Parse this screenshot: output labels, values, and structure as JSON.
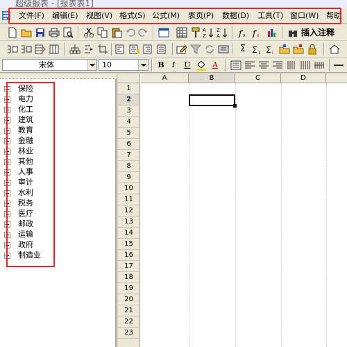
{
  "window": {
    "title": "超级报表 - [报表表1]"
  },
  "menu": {
    "items": [
      {
        "id": "file",
        "label": "文件(F)"
      },
      {
        "id": "edit",
        "label": "编辑(E)"
      },
      {
        "id": "view",
        "label": "视图(V)"
      },
      {
        "id": "format",
        "label": "格式(S)"
      },
      {
        "id": "formula",
        "label": "公式(M)"
      },
      {
        "id": "sheet",
        "label": "表页(P)"
      },
      {
        "id": "data",
        "label": "数据(D)"
      },
      {
        "id": "tools",
        "label": "工具(T)"
      },
      {
        "id": "window",
        "label": "窗口(W)"
      },
      {
        "id": "help",
        "label": "帮助"
      }
    ],
    "highlight_color": "#e0282e"
  },
  "toolbar": {
    "insert_comment_label": "插入注释",
    "sum_symbol": "Σ"
  },
  "format_bar": {
    "font_name": "宋体",
    "font_size": "10",
    "bold": "B",
    "italic": "I",
    "underline": "U",
    "font_color": "A"
  },
  "tree": {
    "items": [
      "保险",
      "电力",
      "化工",
      "建筑",
      "教育",
      "金融",
      "林业",
      "其他",
      "人事",
      "审计",
      "水利",
      "税务",
      "医疗",
      "邮政",
      "运输",
      "政府",
      "制造业"
    ],
    "highlight_color": "#e0282e"
  },
  "sheet": {
    "columns": [
      "A",
      "B",
      "C",
      "D"
    ],
    "rows": [
      "1",
      "2",
      "3",
      "4",
      "5",
      "6",
      "7",
      "8",
      "9",
      "10",
      "11",
      "12",
      "13",
      "14",
      "15",
      "16",
      "17",
      "18",
      "19",
      "20",
      "21",
      "22",
      "23"
    ],
    "selected_column": "B",
    "selected_row": "2"
  }
}
